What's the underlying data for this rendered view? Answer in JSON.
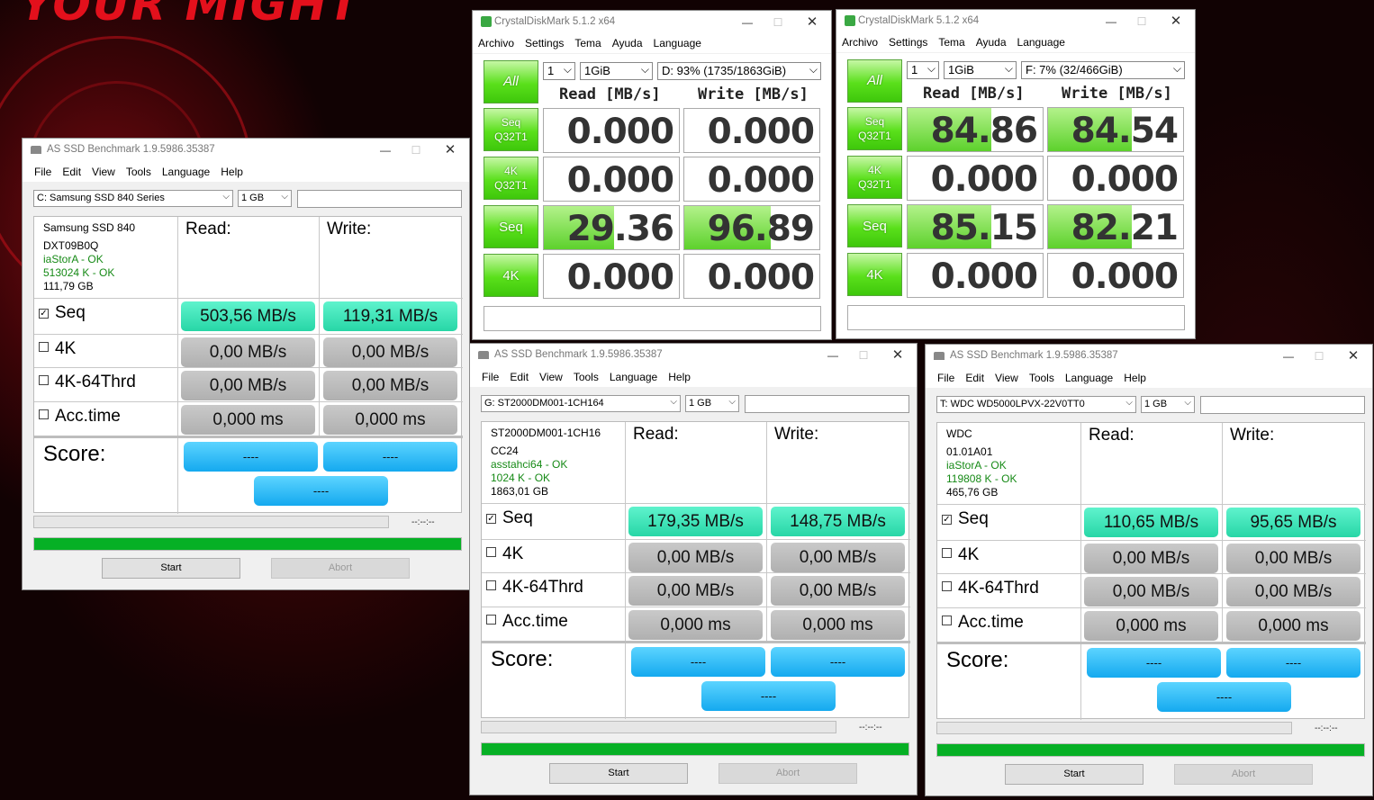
{
  "wallpaper": {
    "slogan": "YOUR MIGHT"
  },
  "as_ssd_1": {
    "title": "AS SSD Benchmark 1.9.5986.35387",
    "menu": [
      "File",
      "Edit",
      "View",
      "Tools",
      "Language",
      "Help"
    ],
    "drive_select": "C: Samsung SSD 840 Series",
    "size_select": "1 GB",
    "info": {
      "model": "Samsung SSD 840",
      "firmware": "DXT09B0Q",
      "driver": "iaStorA - OK",
      "alignment": "513024 K - OK",
      "capacity": "111,79 GB"
    },
    "headers": {
      "read": "Read:",
      "write": "Write:"
    },
    "rows": [
      {
        "label": "Seq",
        "checked": true,
        "read": "503,56 MB/s",
        "write": "119,31 MB/s"
      },
      {
        "label": "4K",
        "checked": false,
        "read": "0,00 MB/s",
        "write": "0,00 MB/s"
      },
      {
        "label": "4K-64Thrd",
        "checked": false,
        "read": "0,00 MB/s",
        "write": "0,00 MB/s"
      },
      {
        "label": "Acc.time",
        "checked": false,
        "read": "0,000 ms",
        "write": "0,000 ms"
      }
    ],
    "score_label": "Score:",
    "score_read": "----",
    "score_write": "----",
    "score_total": "----",
    "timer": "--:--:--",
    "start": "Start",
    "abort": "Abort"
  },
  "as_ssd_2": {
    "title": "AS SSD Benchmark 1.9.5986.35387",
    "menu": [
      "File",
      "Edit",
      "View",
      "Tools",
      "Language",
      "Help"
    ],
    "drive_select": "G: ST2000DM001-1CH164",
    "size_select": "1 GB",
    "info": {
      "model": "ST2000DM001-1CH16",
      "firmware": "CC24",
      "driver": "asstahci64 - OK",
      "alignment": "1024 K - OK",
      "capacity": "1863,01 GB"
    },
    "headers": {
      "read": "Read:",
      "write": "Write:"
    },
    "rows": [
      {
        "label": "Seq",
        "checked": true,
        "read": "179,35 MB/s",
        "write": "148,75 MB/s"
      },
      {
        "label": "4K",
        "checked": false,
        "read": "0,00 MB/s",
        "write": "0,00 MB/s"
      },
      {
        "label": "4K-64Thrd",
        "checked": false,
        "read": "0,00 MB/s",
        "write": "0,00 MB/s"
      },
      {
        "label": "Acc.time",
        "checked": false,
        "read": "0,000 ms",
        "write": "0,000 ms"
      }
    ],
    "score_label": "Score:",
    "score_read": "----",
    "score_write": "----",
    "score_total": "----",
    "timer": "--:--:--",
    "start": "Start",
    "abort": "Abort"
  },
  "as_ssd_3": {
    "title": "AS SSD Benchmark 1.9.5986.35387",
    "menu": [
      "File",
      "Edit",
      "View",
      "Tools",
      "Language",
      "Help"
    ],
    "drive_select": "T: WDC WD5000LPVX-22V0TT0",
    "size_select": "1 GB",
    "info": {
      "model": "WDC",
      "firmware": "01.01A01",
      "driver": "iaStorA - OK",
      "alignment": "119808 K - OK",
      "capacity": "465,76 GB"
    },
    "headers": {
      "read": "Read:",
      "write": "Write:"
    },
    "rows": [
      {
        "label": "Seq",
        "checked": true,
        "read": "110,65 MB/s",
        "write": "95,65 MB/s"
      },
      {
        "label": "4K",
        "checked": false,
        "read": "0,00 MB/s",
        "write": "0,00 MB/s"
      },
      {
        "label": "4K-64Thrd",
        "checked": false,
        "read": "0,00 MB/s",
        "write": "0,00 MB/s"
      },
      {
        "label": "Acc.time",
        "checked": false,
        "read": "0,000 ms",
        "write": "0,000 ms"
      }
    ],
    "score_label": "Score:",
    "score_read": "----",
    "score_write": "----",
    "score_total": "----",
    "timer": "--:--:--",
    "start": "Start",
    "abort": "Abort"
  },
  "cdm_1": {
    "title": "CrystalDiskMark 5.1.2 x64",
    "menu": [
      "Archivo",
      "Settings",
      "Tema",
      "Ayuda",
      "Language"
    ],
    "all": "All",
    "count": "1",
    "size": "1GiB",
    "drive": "D: 93% (1735/1863GiB)",
    "read_header": "Read [MB/s]",
    "write_header": "Write [MB/s]",
    "tests": [
      {
        "line1": "Seq",
        "line2": "Q32T1",
        "read": "0.000",
        "write": "0.000",
        "read_fill": 0,
        "write_fill": 0
      },
      {
        "line1": "4K",
        "line2": "Q32T1",
        "read": "0.000",
        "write": "0.000",
        "read_fill": 0,
        "write_fill": 0
      },
      {
        "line1": "Seq",
        "line2": "",
        "read": "29.36",
        "write": "96.89",
        "read_fill": 0.52,
        "write_fill": 0.64
      },
      {
        "line1": "4K",
        "line2": "",
        "read": "0.000",
        "write": "0.000",
        "read_fill": 0,
        "write_fill": 0
      }
    ]
  },
  "cdm_2": {
    "title": "CrystalDiskMark 5.1.2 x64",
    "menu": [
      "Archivo",
      "Settings",
      "Tema",
      "Ayuda",
      "Language"
    ],
    "all": "All",
    "count": "1",
    "size": "1GiB",
    "drive": "F: 7% (32/466GiB)",
    "read_header": "Read [MB/s]",
    "write_header": "Write [MB/s]",
    "tests": [
      {
        "line1": "Seq",
        "line2": "Q32T1",
        "read": "84.86",
        "write": "84.54",
        "read_fill": 0.62,
        "write_fill": 0.62
      },
      {
        "line1": "4K",
        "line2": "Q32T1",
        "read": "0.000",
        "write": "0.000",
        "read_fill": 0,
        "write_fill": 0
      },
      {
        "line1": "Seq",
        "line2": "",
        "read": "85.15",
        "write": "82.21",
        "read_fill": 0.62,
        "write_fill": 0.62
      },
      {
        "line1": "4K",
        "line2": "",
        "read": "0.000",
        "write": "0.000",
        "read_fill": 0,
        "write_fill": 0
      }
    ]
  },
  "colors": {
    "result_teal": "#27d6a6",
    "result_grey": "#b0b0b0",
    "score_blue": "#14a9ef",
    "progress_green": "#06b025",
    "cdm_green": "#5ae01b"
  }
}
